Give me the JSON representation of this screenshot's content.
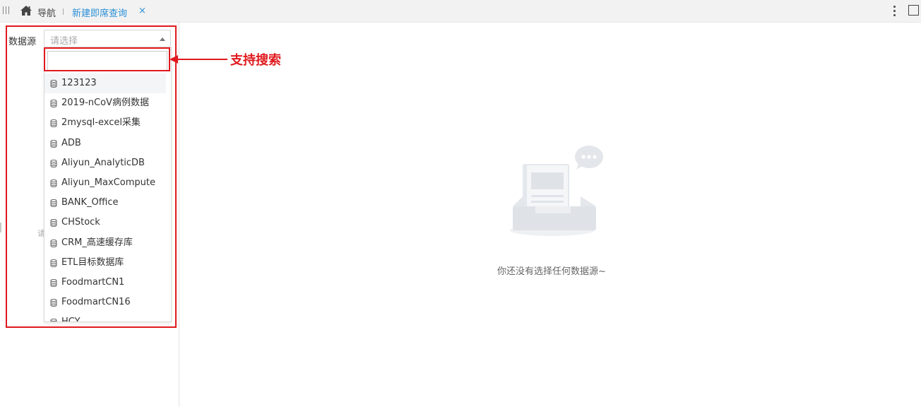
{
  "tabs": {
    "nav_label": "导航",
    "active_tab_label": "新建即席查询",
    "close_glyph": "×"
  },
  "left_panel": {
    "datasource_label": "数据源",
    "select_placeholder": "请选择",
    "search_value": "",
    "hidden_hint": "请",
    "items": [
      {
        "label": "123123"
      },
      {
        "label": "2019-nCoV病例数据"
      },
      {
        "label": "2mysql-excel采集"
      },
      {
        "label": "ADB"
      },
      {
        "label": "Aliyun_AnalyticDB"
      },
      {
        "label": "Aliyun_MaxCompute"
      },
      {
        "label": "BANK_Office"
      },
      {
        "label": "CHStock"
      },
      {
        "label": "CRM_高速缓存库"
      },
      {
        "label": "ETL目标数据库"
      },
      {
        "label": "FoodmartCN1"
      },
      {
        "label": "FoodmartCN16"
      },
      {
        "label": "HCY"
      }
    ]
  },
  "annotation": {
    "text": "支持搜索",
    "color": "#e0191e"
  },
  "main": {
    "empty_text": "你还没有选择任何数据源~"
  },
  "colors": {
    "accent": "#2b8fd6",
    "annotation_red": "#e0191e"
  },
  "icons": [
    "grip-icon",
    "home-icon",
    "close-icon",
    "more-vertical-icon",
    "maximize-icon",
    "caret-up-icon",
    "database-icon",
    "empty-inbox-icon"
  ]
}
